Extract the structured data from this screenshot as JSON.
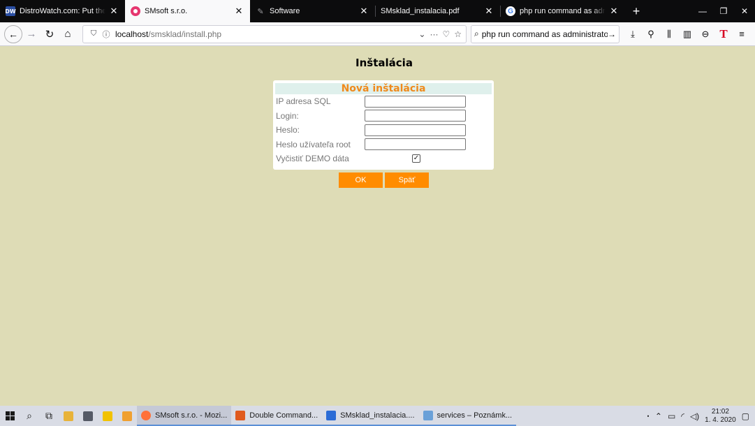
{
  "tabs": [
    {
      "favicon": "distrowatch-icon",
      "favicon_text": "DW",
      "title": "DistroWatch.com: Put the fun i",
      "active": false
    },
    {
      "favicon": "smsoft-icon",
      "title": "SMsoft s.r.o.",
      "active": true
    },
    {
      "favicon": "software-icon",
      "title": "Software",
      "active": false
    },
    {
      "favicon": "pdf-icon",
      "title": "SMsklad_instalacia.pdf",
      "active": false
    },
    {
      "favicon": "google-icon",
      "favicon_text": "G",
      "title": "php run command as administ",
      "active": false
    }
  ],
  "nav": {
    "url_host": "localhost",
    "url_path": "/smsklad/install.php",
    "search_value": "php run command as administrator"
  },
  "page": {
    "title": "Inštalácia",
    "form_header": "Nová inštalácia",
    "fields": {
      "ip_label": "IP adresa SQL",
      "ip_value": "",
      "login_label": "Login:",
      "login_value": "",
      "password_label": "Heslo:",
      "password_value": "",
      "root_password_label": "Heslo užívateľa root",
      "root_password_value": "",
      "clear_demo_label": "Vyčistiť DEMO dáta",
      "clear_demo_checked": true
    },
    "buttons": {
      "ok": "OK",
      "back": "Späť"
    },
    "accent_color": "#ff8c00",
    "background_color": "#dedcb6"
  },
  "taskbar": {
    "tasks": [
      {
        "icon": "firefox-icon",
        "label": "SMsoft s.r.o. - Mozi...",
        "active": true
      },
      {
        "icon": "double-commander-icon",
        "label": "Double Command...",
        "active": false
      },
      {
        "icon": "document-icon",
        "label": "SMsklad_instalacia....",
        "active": false
      },
      {
        "icon": "notepad-icon",
        "label": "services – Poznámk...",
        "active": false
      }
    ],
    "time": "21:02",
    "date": "1. 4. 2020"
  }
}
